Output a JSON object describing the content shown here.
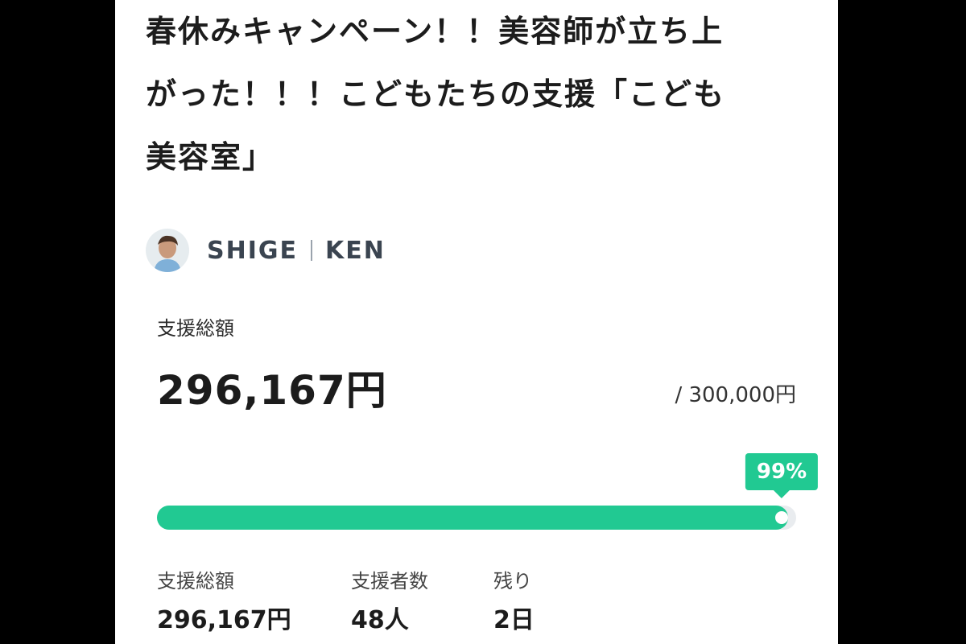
{
  "project": {
    "title_lines": [
      "春休みキャンペーン！！美容師が立ち上",
      "がった！！！こどもたちの支援「こども",
      "美容室」"
    ]
  },
  "owner": {
    "name_left": "SHIGE",
    "name_right": "KEN"
  },
  "funding": {
    "total_label": "支援総額",
    "total_amount": "296,167円",
    "goal": "/ 300,000円",
    "percent_label": "99%",
    "progress_fraction": 0.987
  },
  "stats": [
    {
      "label": "支援総額",
      "value": "296,167円"
    },
    {
      "label": "支援者数",
      "value": "48人"
    },
    {
      "label": "残り",
      "value": "2日"
    }
  ],
  "colors": {
    "accent": "#21c992",
    "track": "#e9ecef",
    "background": "#000000",
    "panel": "#ffffff"
  }
}
